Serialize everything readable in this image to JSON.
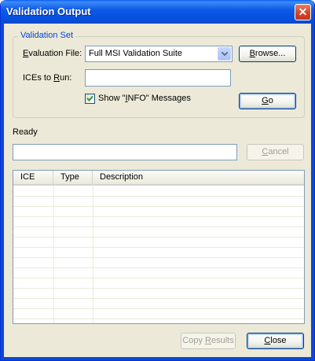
{
  "window": {
    "title": "Validation Output"
  },
  "validation_set": {
    "group_title": "Validation Set",
    "evaluation_file_label_pre": "",
    "evaluation_file_label_mnemonic": "E",
    "evaluation_file_label_post": "valuation File:",
    "evaluation_file_value": "Full MSI Validation Suite",
    "browse_label_pre": "",
    "browse_label_mnemonic": "B",
    "browse_label_post": "rowse...",
    "ices_label_pre": "ICEs to ",
    "ices_label_mnemonic": "R",
    "ices_label_post": "un:",
    "ices_value": "",
    "show_info_pre": "Show \"",
    "show_info_mnemonic": "I",
    "show_info_post": "NFO\" Messages",
    "show_info_checked": true,
    "go_label_pre": "",
    "go_label_mnemonic": "G",
    "go_label_post": "o"
  },
  "status": {
    "text": "Ready",
    "progress_percent": 0,
    "cancel_pre": "",
    "cancel_mnemonic": "C",
    "cancel_post": "ancel"
  },
  "results": {
    "columns": [
      "ICE",
      "Type",
      "Description"
    ],
    "rows": []
  },
  "footer": {
    "copy_pre": "Copy ",
    "copy_mnemonic": "R",
    "copy_post": "esults",
    "close_pre": "",
    "close_mnemonic": "C",
    "close_post": "lose"
  }
}
